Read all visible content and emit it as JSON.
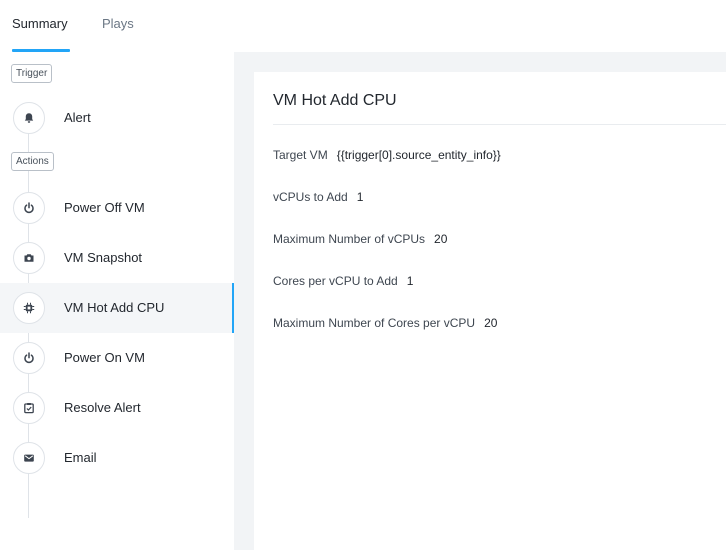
{
  "tabs": [
    {
      "label": "Summary",
      "active": true
    },
    {
      "label": "Plays",
      "active": false
    }
  ],
  "timeline": {
    "trigger_label": "Trigger",
    "actions_label": "Actions",
    "trigger_items": [
      {
        "label": "Alert",
        "icon": "bell-icon"
      }
    ],
    "action_items": [
      {
        "label": "Power Off VM",
        "icon": "power-icon"
      },
      {
        "label": "VM Snapshot",
        "icon": "camera-icon"
      },
      {
        "label": "VM Hot Add CPU",
        "icon": "cpu-icon",
        "active": true
      },
      {
        "label": "Power On VM",
        "icon": "power-icon"
      },
      {
        "label": "Resolve Alert",
        "icon": "checklist-icon"
      },
      {
        "label": "Email",
        "icon": "envelope-icon"
      }
    ]
  },
  "detail": {
    "title": "VM Hot Add CPU",
    "fields": [
      {
        "label": "Target VM",
        "value": "{{trigger[0].source_entity_info}}"
      },
      {
        "label": "vCPUs to Add",
        "value": "1"
      },
      {
        "label": "Maximum Number of vCPUs",
        "value": "20"
      },
      {
        "label": "Cores per vCPU to Add",
        "value": "1"
      },
      {
        "label": "Maximum Number of Cores per vCPU",
        "value": "20"
      }
    ]
  },
  "colors": {
    "accent": "#22a5f7",
    "icon": "#3d4550",
    "panel_bg": "#f2f4f6",
    "active_bg": "#f4f6f8"
  }
}
